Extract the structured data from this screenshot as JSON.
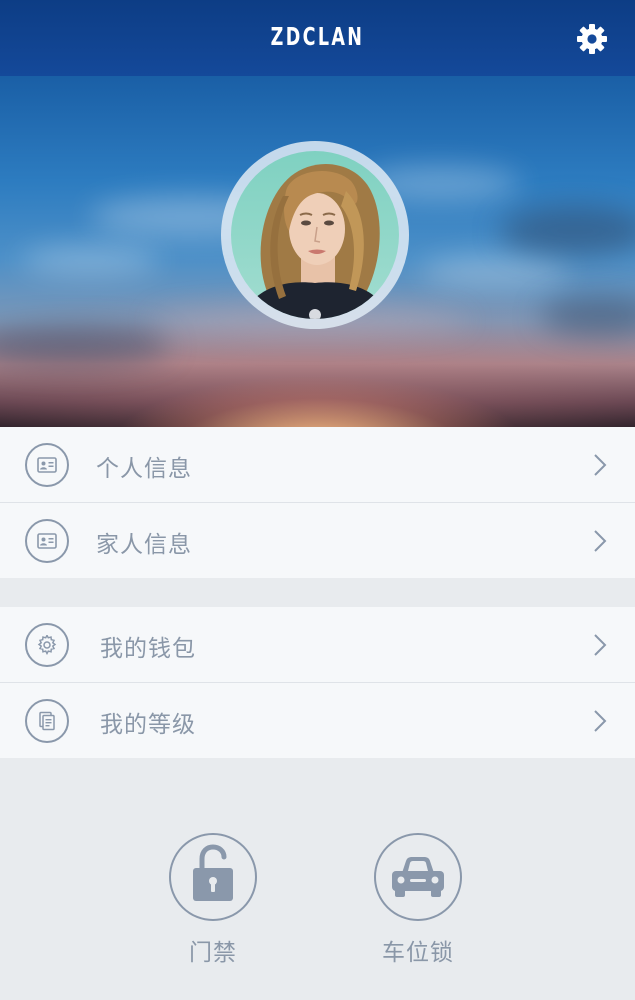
{
  "header": {
    "title": "ZDCLAN",
    "settings_icon": "gear-icon"
  },
  "profile": {
    "avatar_icon": "avatar"
  },
  "menu": {
    "group1": [
      {
        "label": "个人信息",
        "icon": "id-card-icon"
      },
      {
        "label": "家人信息",
        "icon": "id-card-icon"
      }
    ],
    "group2": [
      {
        "label": "我的钱包",
        "icon": "gear-icon"
      },
      {
        "label": "我的等级",
        "icon": "document-icon"
      }
    ]
  },
  "quick_actions": [
    {
      "label": "门禁",
      "icon": "unlock-icon"
    },
    {
      "label": "车位锁",
      "icon": "car-icon"
    }
  ],
  "colors": {
    "header_bg": "#0d3d85",
    "icon_gray": "#8a98ab",
    "text_gray": "#8a97a8",
    "menu_bg": "#f6f8fa",
    "page_bg": "#e8ebee"
  }
}
